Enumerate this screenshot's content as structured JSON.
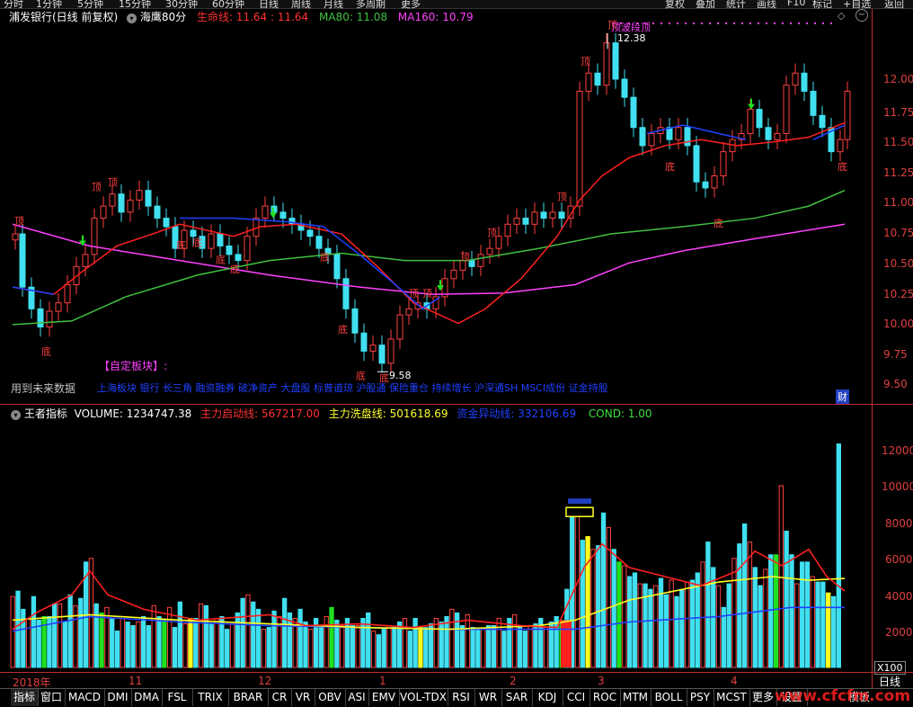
{
  "topbar": {
    "left_items": [
      "分时",
      "1分钟",
      "5分钟",
      "15分钟",
      "30分钟",
      "60分钟",
      "日线",
      "周线",
      "月线",
      "多周期",
      "更多"
    ],
    "right_items": [
      "复权",
      "叠加",
      "统计",
      "画线",
      "F10",
      "标记",
      "+自选",
      "返回"
    ]
  },
  "header": {
    "stock": "浦发银行(日线 前复权)",
    "indicator": "海鹰80分",
    "life_line": "生命线: 11.64 : 11.64",
    "ma80": "MA80: 11.08",
    "ma160": "MA160: 10.79"
  },
  "price_axis": [
    "12.00",
    "11.75",
    "11.50",
    "11.25",
    "11.00",
    "10.75",
    "10.50",
    "10.25",
    "10.00",
    "9.75",
    "9.50"
  ],
  "annotations": {
    "high_label": "12.38",
    "high_tag": "顶波段顶",
    "low_label": "9.58",
    "future_data": "用到未来数据",
    "custom_block_title": "【自定板块】:",
    "custom_blocks": "上海板块 银行 长三角 融资融券 破净资产 大盘股 标普道琼 沪股通 保险重仓 持续增长 沪深通SH MSCI成份 证金持股",
    "fin_marker": "财",
    "top_char": "顶",
    "bottom_char": "底"
  },
  "vol_header": {
    "name": "王者指标",
    "volume": "VOLUME: 1234747.38",
    "main_start": "主力启动线: 567217.00",
    "main_wash": "主力洗盘线: 501618.69",
    "capital_move": "资金异动线: 332106.69",
    "cond": "COND: 1.00"
  },
  "vol_axis": [
    "12000",
    "10000",
    "8000",
    "6000",
    "4000",
    "2000"
  ],
  "vol_unit": "X100",
  "date_axis": {
    "year_label": "2018年",
    "months": [
      "11",
      "12",
      "1",
      "2",
      "3",
      "4"
    ],
    "period": "日线"
  },
  "bottom_tabs": [
    "指标",
    "窗口",
    "MACD",
    "DMI",
    "DMA",
    "FSL",
    "TRIX",
    "BRAR",
    "CR",
    "VR",
    "OBV",
    "ASI",
    "EMV",
    "VOL-TDX",
    "RSI",
    "WR",
    "SAR",
    "KDJ",
    "CCI",
    "ROC",
    "MTM",
    "BOLL",
    "PSY",
    "MCST",
    "更多",
    "设置"
  ],
  "bottom_right": "模板",
  "watermark": "www.cfcfm.com",
  "colors": {
    "life_line": "#ff2020",
    "ma80": "#40c040",
    "ma160": "#ff40ff",
    "blue_line": "#2040ff",
    "up_candle": "#ff4040",
    "down_candle": "#40e0f0",
    "yellow_bar": "#ffff20",
    "green_bar": "#20e020"
  }
}
